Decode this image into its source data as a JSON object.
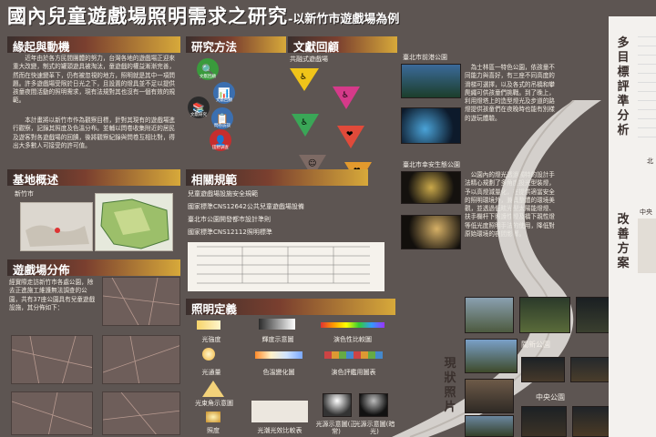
{
  "title": {
    "main": "國內兒童遊戲場照明需求之研究",
    "sub": "-以新竹市遊戲場為例"
  },
  "sections": {
    "origin": {
      "heading": "緣起與動機",
      "p1": "近年由於各方民間團體的努力，台灣各地的遊戲場正迎來重大改變，制式的罐頭遊具被淘汰，童遊戲的權益漸漸完善，然而在快速變革下，仍有被忽視的地方，照明就是其中一項問題。許多遊戲場受限於日光之下，且設置的燈具並不足以提供孩童夜間活動的照明需求，現有法規對其也沒有一個有效的規範。",
      "p2": "本計畫將以新竹市作為觀察目標，針對其現有的遊戲場進行觀察，記錄其照度及色溫分布。並輔以問卷收集附近的居民及遊客對各遊戲場的回饋，後將觀察紀錄與問卷互相比對，得出大多數人可接受的許可值。"
    },
    "methods": {
      "heading": "研究方法",
      "items": [
        {
          "icon": "search-icon",
          "caption": "文獻回顧"
        },
        {
          "icon": "chart-icon",
          "caption": "文獻回顧"
        },
        {
          "icon": "books-icon",
          "caption": "文獻研究"
        },
        {
          "icon": "survey-icon",
          "caption": "問卷訪談"
        },
        {
          "icon": "person-icon",
          "caption": "田野調查"
        }
      ]
    },
    "literature": {
      "heading": "文獻回顧",
      "sub": "共融式遊戲場",
      "tri_icons": [
        "♿",
        "♿",
        "♿",
        "❤",
        "☺",
        "❤"
      ]
    },
    "taipei1": {
      "heading": "臺北市前港公園",
      "text": "為士林區一特色公園，依孩童不同能力與喜好，有三座不同高度的滑梯可選擇，以及各式的吊橋和攀爬繩可供孩童們挑戰。到了晚上，利用燈塔上的造型燈光及步道的路燈提供孩童們在夜晚時也能有別樣的遊玩體驗。"
    },
    "taipei2": {
      "heading": "臺北市幸安生態公園",
      "text": "公園內的燈光透過獨特的設計手法精心規劃了多角度投光型裝燈，予以高燈減量化，在提供適當安全的照明環境外，兼具整體的環境美觀，並透過低眩光型太陽能燈燈、扶手欄杆下照護性燈及橋下親性燈等低光度照明手法的使用，降低對原始環境的夜間影響。"
    },
    "site": {
      "heading": "基地概述",
      "city": "新竹市"
    },
    "regs": {
      "heading": "相關規範",
      "items": [
        "兒童遊戲場設施安全規範",
        "國家標準CNS12642公共兒童遊戲場設備",
        "臺北市公園開發都市設計準則",
        "國家標準CNS12112照明標準"
      ]
    },
    "distribution": {
      "heading": "遊戲場分佈",
      "text": "經實際走訪新竹市各處公園，除去正進施工維護無法調查的公園，共有37座公園具有兒童遊戲設施，其分佈如下："
    },
    "lighting": {
      "heading": "照明定義",
      "items": [
        "光強度",
        "輝度示意圖",
        "演色性比較圖",
        "光通量",
        "色溫變化圖",
        "演色評鑑用圖表",
        "光束角示意圖",
        "照度",
        "光潮光效比較表",
        "光源示意圖(正常)",
        "光源示意圖(暗光)"
      ]
    },
    "right": {
      "criteria": "多目標評準分析",
      "improve": "改善方案",
      "photos": "現狀照片",
      "north": "北",
      "central": "中央"
    },
    "parks": {
      "guanxin": "關新公園",
      "central": "中央公園"
    }
  },
  "colors": {
    "bg": "#5d5552",
    "accent": "#d7a93a",
    "panel": "#f3f1ee"
  }
}
